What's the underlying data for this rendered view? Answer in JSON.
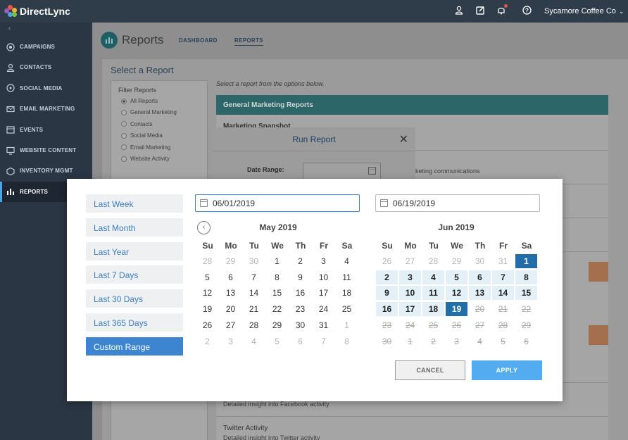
{
  "app": {
    "brand": "DirectLync",
    "account": "Sycamore Coffee Co",
    "logo_colors": [
      "#e8554e",
      "#f2b134",
      "#4aa3e4",
      "#7bc043",
      "#a05db5"
    ]
  },
  "sidebar": {
    "items": [
      {
        "label": "CAMPAIGNS",
        "icon": "target-icon"
      },
      {
        "label": "CONTACTS",
        "icon": "person-icon"
      },
      {
        "label": "SOCIAL MEDIA",
        "icon": "chat-icon"
      },
      {
        "label": "EMAIL MARKETING",
        "icon": "mail-icon"
      },
      {
        "label": "EVENTS",
        "icon": "calendar-icon"
      },
      {
        "label": "WEBSITE CONTENT",
        "icon": "monitor-icon"
      },
      {
        "label": "INVENTORY MGMT",
        "icon": "box-icon"
      },
      {
        "label": "REPORTS",
        "icon": "bar-chart-icon",
        "active": true
      }
    ]
  },
  "page": {
    "title": "Reports",
    "tabs": [
      "DASHBOARD",
      "REPORTS"
    ],
    "section_title": "Select a Report",
    "hint": "Select a report from the options below.",
    "filter": {
      "title": "Filter Reports",
      "options": [
        "All Reports",
        "General Marketing",
        "Contacts",
        "Social Media",
        "Email Marketing",
        "Website Activity"
      ]
    },
    "group_header": "General Marketing Reports",
    "rows": [
      {
        "title": "Marketing Snapshot",
        "desc": ""
      },
      {
        "title": "",
        "desc": "rketing communications"
      },
      {
        "title": "",
        "desc": "Detailed insight into Facebook activity"
      },
      {
        "title": "Twitter Activity",
        "desc": "Detailed insight into Twitter activity"
      }
    ]
  },
  "run_report": {
    "title": "Run Report",
    "date_label": "Date Range:"
  },
  "picker": {
    "ranges": [
      "Last Week",
      "Last Month",
      "Last Year",
      "Last 7 Days",
      "Last 30 Days",
      "Last 365 Days",
      "Custom Range"
    ],
    "active_range": "Custom Range",
    "start_date": "06/01/2019",
    "end_date": "06/19/2019",
    "weekdays": [
      "Su",
      "Mo",
      "Tu",
      "We",
      "Th",
      "Fr",
      "Sa"
    ],
    "months": [
      {
        "title": "May 2019",
        "weeks": [
          [
            [
              "28",
              "m"
            ],
            [
              "29",
              "m"
            ],
            [
              "30",
              "m"
            ],
            [
              "1",
              ""
            ],
            [
              "2",
              ""
            ],
            [
              "3",
              ""
            ],
            [
              "4",
              ""
            ]
          ],
          [
            [
              "5",
              ""
            ],
            [
              "6",
              ""
            ],
            [
              "7",
              ""
            ],
            [
              "8",
              ""
            ],
            [
              "9",
              ""
            ],
            [
              "10",
              ""
            ],
            [
              "11",
              ""
            ]
          ],
          [
            [
              "12",
              ""
            ],
            [
              "13",
              ""
            ],
            [
              "14",
              ""
            ],
            [
              "15",
              ""
            ],
            [
              "16",
              ""
            ],
            [
              "17",
              ""
            ],
            [
              "18",
              ""
            ]
          ],
          [
            [
              "19",
              ""
            ],
            [
              "20",
              ""
            ],
            [
              "21",
              ""
            ],
            [
              "22",
              ""
            ],
            [
              "23",
              ""
            ],
            [
              "24",
              ""
            ],
            [
              "25",
              ""
            ]
          ],
          [
            [
              "26",
              ""
            ],
            [
              "27",
              ""
            ],
            [
              "28",
              ""
            ],
            [
              "29",
              ""
            ],
            [
              "30",
              ""
            ],
            [
              "31",
              ""
            ],
            [
              "1",
              "m"
            ]
          ],
          [
            [
              "2",
              "m"
            ],
            [
              "3",
              "m"
            ],
            [
              "4",
              "m"
            ],
            [
              "5",
              "m"
            ],
            [
              "6",
              "m"
            ],
            [
              "7",
              "m"
            ],
            [
              "8",
              "m"
            ]
          ]
        ]
      },
      {
        "title": "Jun 2019",
        "weeks": [
          [
            [
              "26",
              "m"
            ],
            [
              "27",
              "m"
            ],
            [
              "28",
              "m"
            ],
            [
              "29",
              "m"
            ],
            [
              "30",
              "m"
            ],
            [
              "31",
              "m"
            ],
            [
              "1",
              "s"
            ]
          ],
          [
            [
              "2",
              "r"
            ],
            [
              "3",
              "r"
            ],
            [
              "4",
              "r"
            ],
            [
              "5",
              "r"
            ],
            [
              "6",
              "r"
            ],
            [
              "7",
              "r"
            ],
            [
              "8",
              "r"
            ]
          ],
          [
            [
              "9",
              "r"
            ],
            [
              "10",
              "r"
            ],
            [
              "11",
              "r"
            ],
            [
              "12",
              "r"
            ],
            [
              "13",
              "r"
            ],
            [
              "14",
              "r"
            ],
            [
              "15",
              "r"
            ]
          ],
          [
            [
              "16",
              "r"
            ],
            [
              "17",
              "r"
            ],
            [
              "18",
              "r"
            ],
            [
              "19",
              "s"
            ],
            [
              "20",
              "d"
            ],
            [
              "21",
              "d"
            ],
            [
              "22",
              "d"
            ]
          ],
          [
            [
              "23",
              "d"
            ],
            [
              "24",
              "d"
            ],
            [
              "25",
              "d"
            ],
            [
              "26",
              "d"
            ],
            [
              "27",
              "d"
            ],
            [
              "28",
              "d"
            ],
            [
              "29",
              "d"
            ]
          ],
          [
            [
              "30",
              "d"
            ],
            [
              "1",
              "d"
            ],
            [
              "2",
              "d"
            ],
            [
              "3",
              "d"
            ],
            [
              "4",
              "d"
            ],
            [
              "5",
              "d"
            ],
            [
              "6",
              "d"
            ]
          ]
        ]
      }
    ],
    "cancel_label": "CANCEL",
    "apply_label": "APPLY"
  }
}
